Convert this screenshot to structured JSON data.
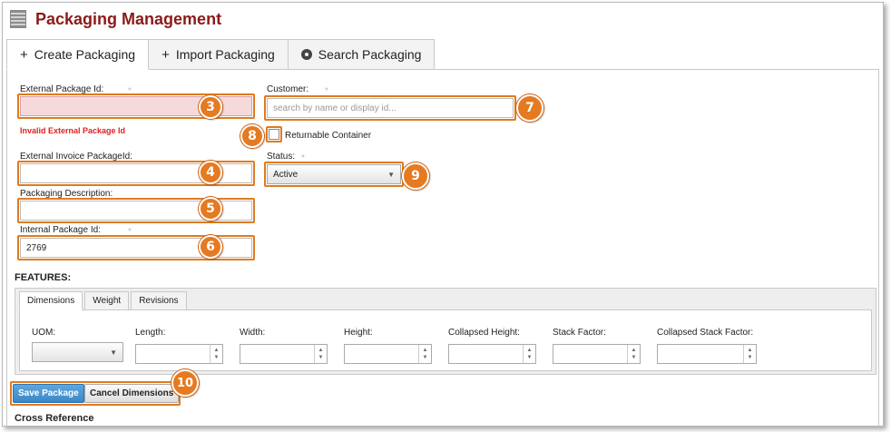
{
  "app": {
    "title": "Packaging Management",
    "icon": "app-logo-icon"
  },
  "tabs": [
    {
      "label": "Create Packaging",
      "icon": "+"
    },
    {
      "label": "Import Packaging",
      "icon": "+"
    },
    {
      "label": "Search Packaging",
      "icon": "search-icon"
    }
  ],
  "form": {
    "external_package_id": {
      "label": "External Package Id:",
      "required": "*",
      "value": "",
      "error": "Invalid External Package Id"
    },
    "external_invoice_package_id": {
      "label": "External Invoice PackageId:",
      "value": ""
    },
    "packaging_description": {
      "label": "Packaging Description:",
      "value": ""
    },
    "internal_package_id": {
      "label": "Internal Package Id:",
      "required": "*",
      "value": "2769"
    },
    "customer": {
      "label": "Customer:",
      "required": "*",
      "placeholder": "search by name or display id..."
    },
    "returnable_container": {
      "label": "Returnable Container",
      "checked": false
    },
    "status": {
      "label": "Status:",
      "required": "*",
      "value": "Active"
    }
  },
  "features": {
    "title": "FEATURES:",
    "tabs": [
      "Dimensions",
      "Weight",
      "Revisions"
    ],
    "dimension_fields": [
      {
        "label": "UOM:",
        "value": ""
      },
      {
        "label": "Length:",
        "value": ""
      },
      {
        "label": "Width:",
        "value": ""
      },
      {
        "label": "Height:",
        "value": ""
      },
      {
        "label": "Collapsed Height:",
        "value": ""
      },
      {
        "label": "Stack Factor:",
        "value": ""
      },
      {
        "label": "Collapsed Stack Factor:",
        "value": ""
      }
    ]
  },
  "buttons": {
    "save": "Save Package",
    "cancel": "Cancel Dimensions"
  },
  "cross_reference": {
    "title": "Cross Reference"
  },
  "callouts": [
    "3",
    "4",
    "5",
    "6",
    "7",
    "8",
    "9",
    "10"
  ],
  "colors": {
    "title": "#8b1a1a",
    "callout": "#e57a21",
    "error": "#e02020",
    "primary_button": "#3a87c8"
  }
}
